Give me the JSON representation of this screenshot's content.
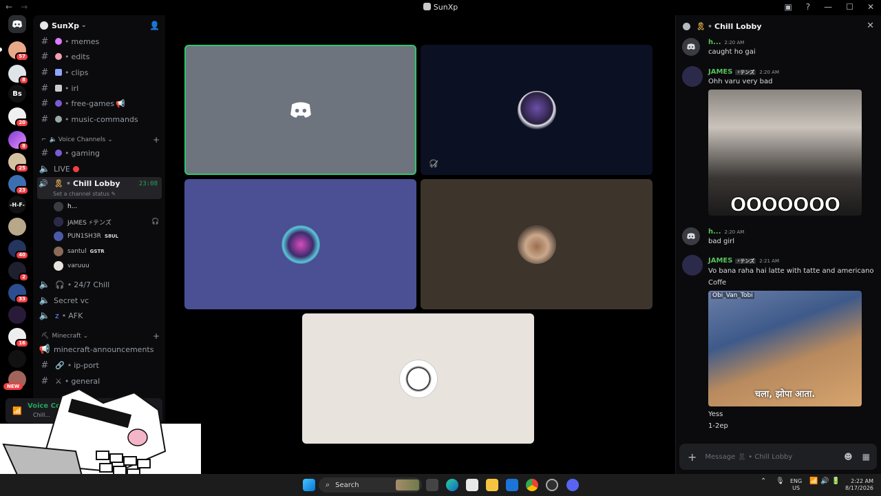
{
  "window": {
    "title": "SunXp"
  },
  "server": {
    "name": "SunXp"
  },
  "rail": {
    "badges": [
      "57",
      "8",
      "20",
      "8",
      "25",
      "23",
      "40",
      "2",
      "33",
      "16"
    ],
    "text_icons": [
      "Bs",
      "-H-F-"
    ],
    "new_label": "NEW"
  },
  "channels": {
    "text_top": [
      {
        "name": "memes"
      },
      {
        "name": "edits"
      },
      {
        "name": "clips"
      },
      {
        "name": "irl"
      },
      {
        "name": "free-games"
      },
      {
        "name": "music-commands"
      }
    ],
    "voice_category": "Voice Channels",
    "gaming": "gaming",
    "live": "LIVE",
    "chill_lobby": "Chill Lobby",
    "chill_timer": "23:08",
    "set_status": "Set a channel status",
    "voice_users": [
      {
        "name": "h...",
        "tag": ""
      },
      {
        "name": "JAMES ⚡テンズ",
        "tag": ""
      },
      {
        "name": "PUN1SH3R",
        "tag": "S8UL"
      },
      {
        "name": "santul",
        "tag": "GSTR"
      },
      {
        "name": "varuuu",
        "tag": ""
      }
    ],
    "chill_247": "24/7 Chill",
    "secret_vc": "Secret vc",
    "afk": "AFK",
    "minecraft_category": "Minecraft",
    "mc_announcements": "minecraft-announcements",
    "ip_port": "ip-port",
    "general": "general"
  },
  "userpanel": {
    "vc_label": "Voice Co...",
    "vc_sub": "Chill..."
  },
  "panel": {
    "title": "Chill Lobby",
    "composer_placeholder": "Message 🎗 • Chill Lobby",
    "messages": [
      {
        "author": "h...",
        "time": "2:20 AM",
        "text": "caught ho gai"
      },
      {
        "author": "JAMES",
        "tag": "⚡テンズ",
        "time": "2:20 AM",
        "text": "Ohh varu very bad",
        "gif_caption": "OOOOOOO"
      },
      {
        "author": "h...",
        "time": "2:20 AM",
        "text": "bad girl"
      },
      {
        "author": "JAMES",
        "tag": "⚡テンズ",
        "time": "2:21 AM",
        "text": "Vo bana raha hai latte with tatte and americano",
        "text2": "Coffe",
        "gif_watermark": "Obi_Van_Tobi",
        "gif_subtitle": "चला, झोपा आता."
      },
      {
        "text": "Yess"
      },
      {
        "text": "1-2ep"
      }
    ]
  },
  "taskbar": {
    "search": "Search",
    "lang": "ENG",
    "region": "US",
    "time": "2:22 AM",
    "date": "8/17/2026"
  },
  "colors": {
    "accent_green": "#23a55a",
    "name_green": "#57c25b",
    "blurple": "#5865f2"
  }
}
